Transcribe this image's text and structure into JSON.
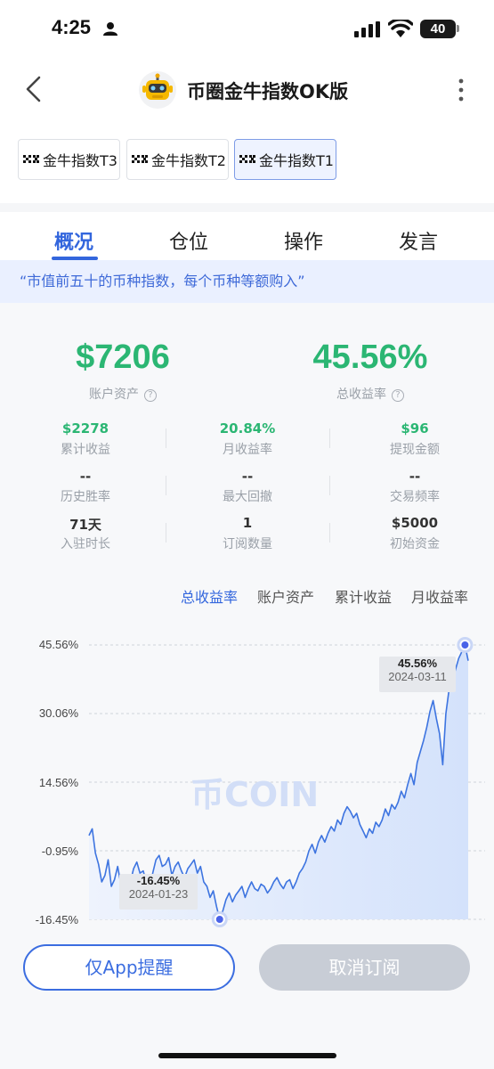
{
  "status_bar": {
    "time": "4:25",
    "battery": "40"
  },
  "header": {
    "title": "币圈金牛指数OK版"
  },
  "index_tabs": [
    {
      "label": "金牛指数T3",
      "active": false
    },
    {
      "label": "金牛指数T2",
      "active": false
    },
    {
      "label": "金牛指数T1",
      "active": true
    }
  ],
  "tabs": [
    {
      "label": "概况",
      "active": true
    },
    {
      "label": "仓位",
      "active": false
    },
    {
      "label": "操作",
      "active": false
    },
    {
      "label": "发言",
      "active": false
    }
  ],
  "description": "“市值前五十的币种指数，每个币种等额购入”",
  "summary": {
    "account_assets": {
      "value": "$7206",
      "label": "账户资产"
    },
    "total_return": {
      "value": "45.56%",
      "label": "总收益率"
    }
  },
  "stats": [
    {
      "value": "$2278",
      "label": "累计收益",
      "color": "green"
    },
    {
      "value": "20.84%",
      "label": "月收益率",
      "color": "green"
    },
    {
      "value": "$96",
      "label": "提现金额",
      "color": "green"
    },
    {
      "value": "--",
      "label": "历史胜率",
      "color": "dark"
    },
    {
      "value": "--",
      "label": "最大回撤",
      "color": "dark"
    },
    {
      "value": "--",
      "label": "交易频率",
      "color": "dark"
    },
    {
      "value": "71天",
      "label": "入驻时长",
      "color": "dark"
    },
    {
      "value": "1",
      "label": "订阅数量",
      "color": "dark"
    },
    {
      "value": "$5000",
      "label": "初始资金",
      "color": "dark"
    }
  ],
  "chart_tabs": [
    {
      "label": "总收益率",
      "active": true
    },
    {
      "label": "账户资产",
      "active": false
    },
    {
      "label": "累计收益",
      "active": false
    },
    {
      "label": "月收益率",
      "active": false
    }
  ],
  "chart_data": {
    "type": "area",
    "y_tick_labels": [
      "45.56%",
      "30.06%",
      "14.56%",
      "-0.95%",
      "-16.45%"
    ],
    "ylim": [
      -16.45,
      45.56
    ],
    "grid": true,
    "series": [
      {
        "values": [
          2.5,
          4.0,
          -1.5,
          -4.0,
          -8.0,
          -6.5,
          -3.0,
          -9.0,
          -7.5,
          -4.5,
          -8.5,
          -10.5,
          -7.0,
          -8.0,
          -5.0,
          -3.5,
          -6.0,
          -5.5,
          -8.0,
          -9.5,
          -6.0,
          -3.0,
          -2.0,
          -4.5,
          -4.0,
          -2.5,
          -6.5,
          -4.5,
          -3.5,
          -5.5,
          -7.0,
          -5.0,
          -4.0,
          -3.0,
          -6.0,
          -4.5,
          -8.0,
          -9.0,
          -11.5,
          -10.0,
          -13.5,
          -16.45,
          -14.5,
          -12.0,
          -10.5,
          -12.5,
          -11.0,
          -10.0,
          -9.0,
          -11.5,
          -9.5,
          -8.0,
          -9.5,
          -10.0,
          -8.5,
          -9.0,
          -10.5,
          -9.5,
          -8.0,
          -7.0,
          -8.5,
          -9.5,
          -8.0,
          -7.5,
          -9.5,
          -8.0,
          -6.0,
          -5.0,
          -3.5,
          -1.0,
          0.5,
          -1.5,
          1.0,
          2.5,
          1.0,
          3.0,
          4.5,
          3.5,
          6.0,
          5.0,
          7.5,
          9.0,
          8.0,
          6.5,
          7.5,
          5.0,
          3.5,
          2.0,
          4.0,
          3.0,
          5.5,
          4.5,
          6.0,
          8.5,
          7.0,
          9.5,
          8.5,
          10.0,
          12.5,
          11.0,
          14.0,
          16.5,
          14.0,
          19.0,
          21.5,
          24.0,
          27.0,
          30.5,
          33.0,
          29.0,
          25.5,
          18.5,
          30.0,
          35.5,
          37.0,
          40.0,
          42.5,
          44.0,
          45.56,
          42.0
        ]
      }
    ],
    "annotations": [
      {
        "value": "45.56%",
        "date": "2024-03-11",
        "type": "max"
      },
      {
        "value": "-16.45%",
        "date": "2024-01-23",
        "type": "min"
      }
    ],
    "watermark": "币COIN"
  },
  "actions": {
    "notify": "仅App提醒",
    "unsubscribe": "取消订阅"
  },
  "colors": {
    "accent": "#3366dd",
    "positive": "#2bb673",
    "chart_fill": "#dbe6fb",
    "chart_line": "#3d74e0"
  }
}
